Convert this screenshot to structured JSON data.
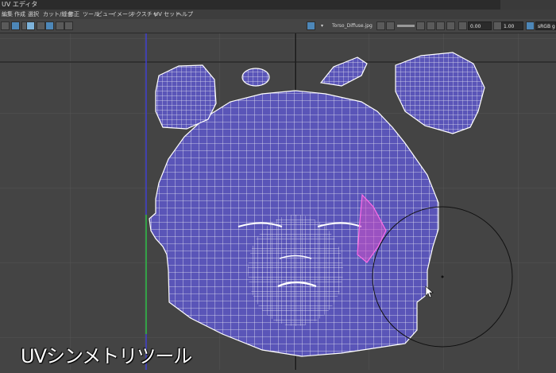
{
  "window": {
    "title": "UV エディタ"
  },
  "menu": {
    "items": [
      "編集",
      "作成",
      "選択",
      "カット/縫合",
      "修正",
      "ツール",
      "ビュー",
      "イメージ",
      "テクスチャ",
      "UV セット",
      "ヘルプ"
    ]
  },
  "toolbar": {
    "texture_name": "Torso_Diffuse.jpg",
    "value_a": "0.00",
    "value_b": "1.00",
    "color_space": "sRGB gamma"
  },
  "caption": "UVシンメトリツール",
  "colors": {
    "background": "#444444",
    "uv_shell_fill": "#5a55b8",
    "uv_wire": "#ffffff",
    "grid_line": "#555555",
    "axis_u": "#3f3fd0",
    "axis_v": "#2fbf2f",
    "selection": "#e060d0"
  }
}
